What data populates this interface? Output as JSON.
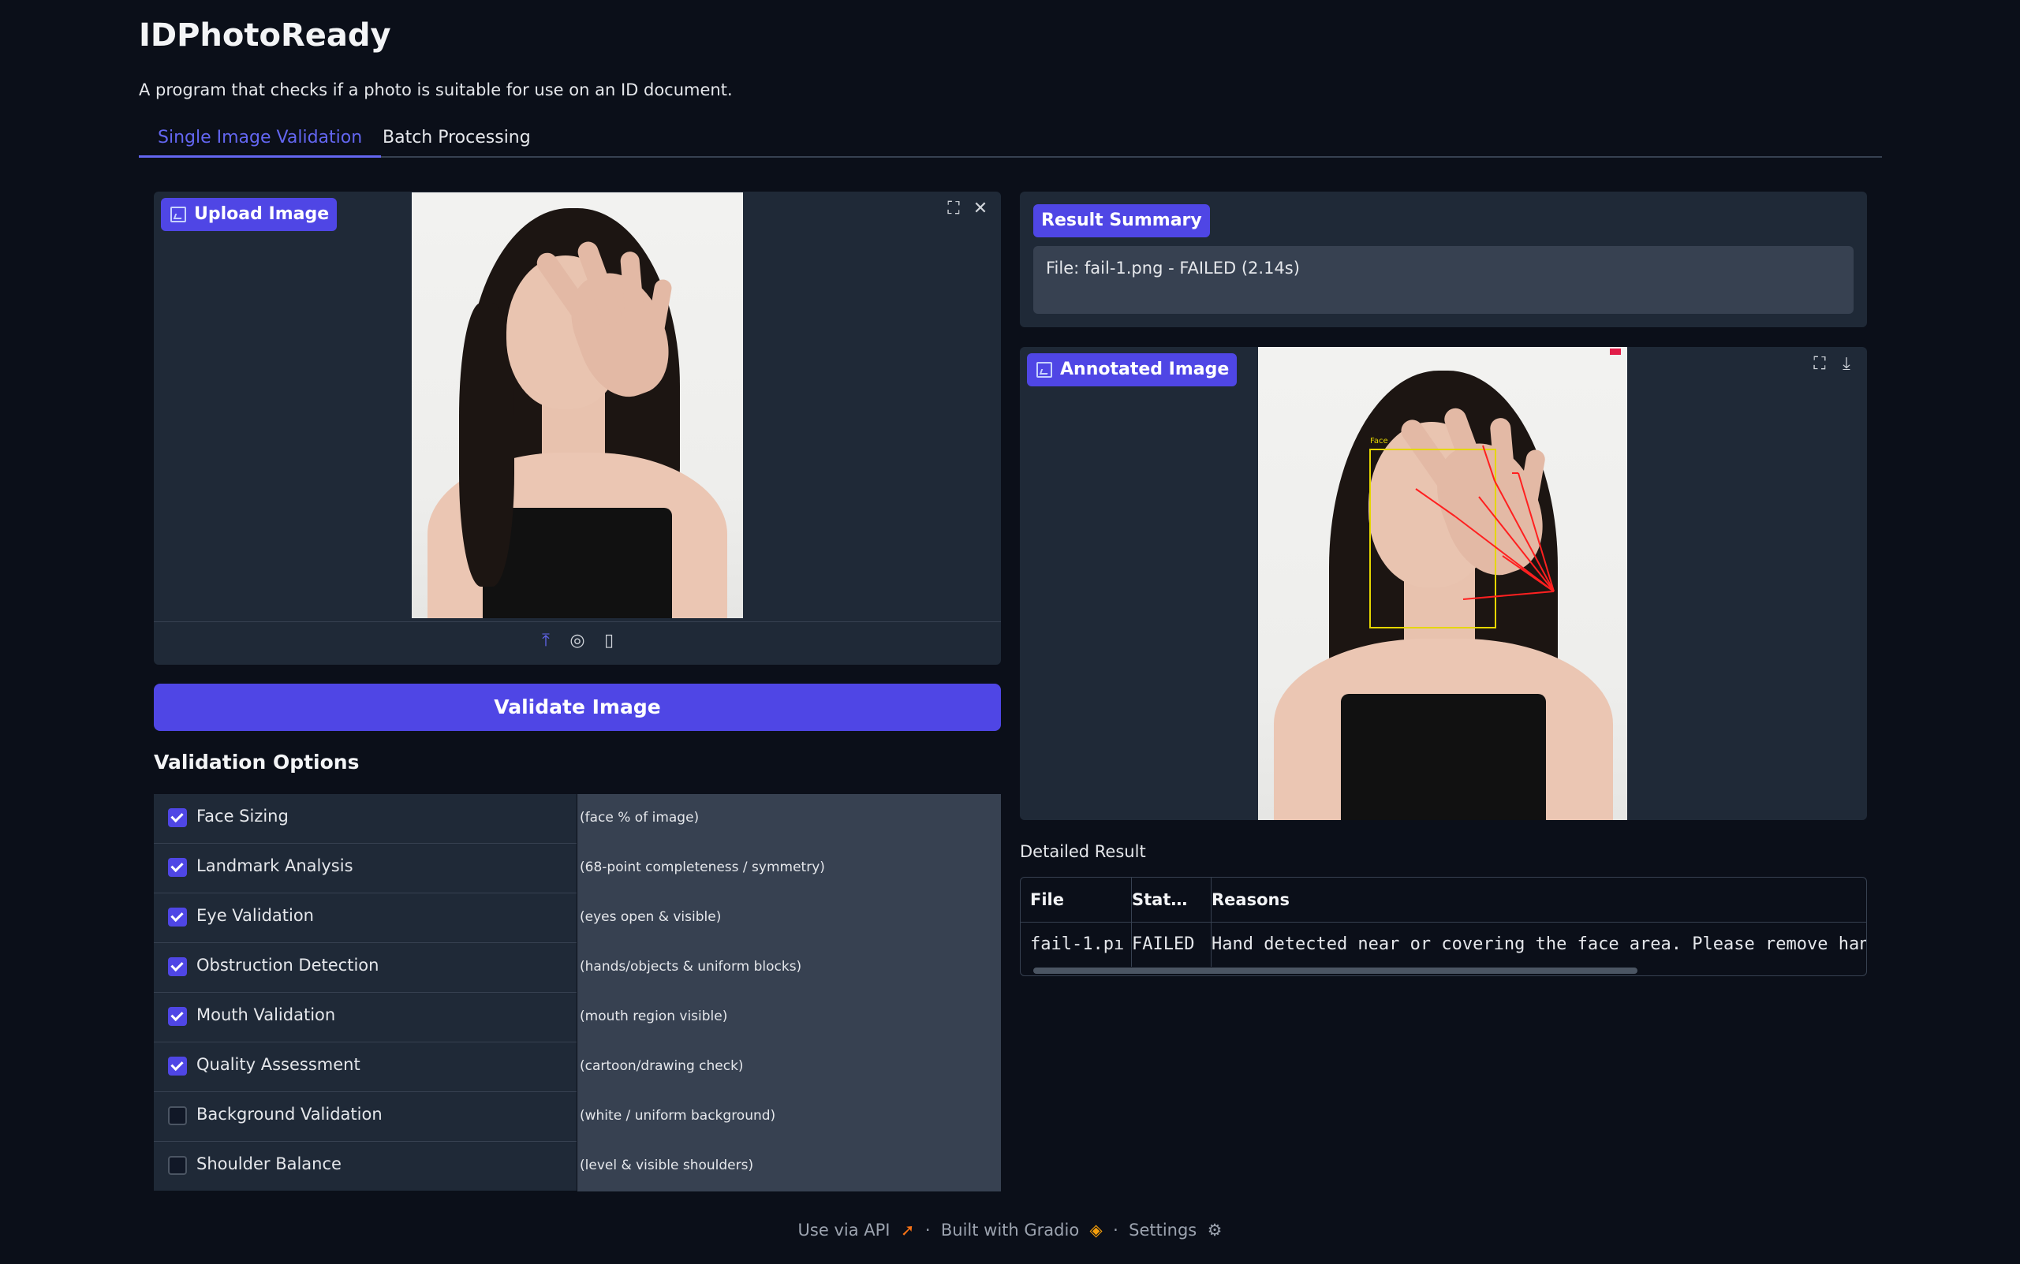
{
  "app": {
    "title": "IDPhotoReady",
    "subtitle": "A program that checks if a photo is suitable for use on an ID document."
  },
  "tabs": [
    {
      "label": "Single Image Validation",
      "active": true
    },
    {
      "label": "Batch Processing",
      "active": false
    }
  ],
  "upload": {
    "label": "Upload Image",
    "icons": [
      "upload-icon",
      "webcam-icon",
      "clipboard-icon"
    ],
    "corner_icons": [
      "fullscreen-icon",
      "close-icon"
    ]
  },
  "validate_button": "Validate Image",
  "options_title": "Validation Options",
  "options": [
    {
      "label": "Face Sizing",
      "desc": "(face % of image)",
      "checked": true
    },
    {
      "label": "Landmark Analysis",
      "desc": "(68-point completeness / symmetry)",
      "checked": true
    },
    {
      "label": "Eye Validation",
      "desc": "(eyes open & visible)",
      "checked": true
    },
    {
      "label": "Obstruction Detection",
      "desc": "(hands/objects & uniform blocks)",
      "checked": true
    },
    {
      "label": "Mouth Validation",
      "desc": "(mouth region visible)",
      "checked": true
    },
    {
      "label": "Quality Assessment",
      "desc": "(cartoon/drawing check)",
      "checked": true
    },
    {
      "label": "Background Validation",
      "desc": "(white / uniform background)",
      "checked": false
    },
    {
      "label": "Shoulder Balance",
      "desc": "(level & visible shoulders)",
      "checked": false
    }
  ],
  "summary": {
    "label": "Result Summary",
    "text": "File: fail-1.png - FAILED (2.14s)"
  },
  "annotated": {
    "label": "Annotated Image",
    "face_box_label": "Face",
    "corner_icons": [
      "fullscreen-icon",
      "download-icon"
    ]
  },
  "detail": {
    "label": "Detailed Result",
    "headers": [
      "File",
      "Stat…",
      "Reasons"
    ],
    "row": [
      "fail-1.pı",
      "FAILED",
      "Hand detected near or covering the face area. Please remove hands"
    ]
  },
  "footer": {
    "api": "Use via API",
    "built": "Built with Gradio",
    "settings": "Settings",
    "sep": "·"
  },
  "colors": {
    "background": "#0b0f19",
    "accent": "#4f46e5",
    "panel": "#1f2937"
  }
}
